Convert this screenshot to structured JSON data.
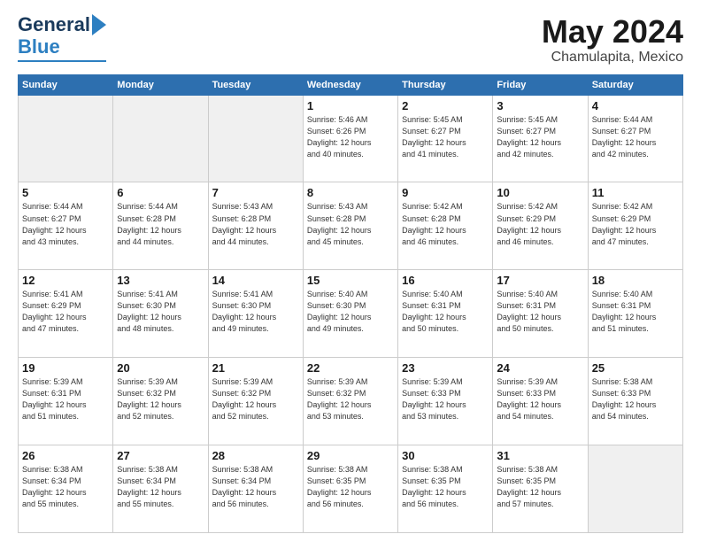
{
  "header": {
    "logo_general": "General",
    "logo_blue": "Blue",
    "title": "May 2024",
    "location": "Chamulapita, Mexico"
  },
  "weekdays": [
    "Sunday",
    "Monday",
    "Tuesday",
    "Wednesday",
    "Thursday",
    "Friday",
    "Saturday"
  ],
  "weeks": [
    [
      {
        "day": "",
        "info": ""
      },
      {
        "day": "",
        "info": ""
      },
      {
        "day": "",
        "info": ""
      },
      {
        "day": "1",
        "info": "Sunrise: 5:46 AM\nSunset: 6:26 PM\nDaylight: 12 hours\nand 40 minutes."
      },
      {
        "day": "2",
        "info": "Sunrise: 5:45 AM\nSunset: 6:27 PM\nDaylight: 12 hours\nand 41 minutes."
      },
      {
        "day": "3",
        "info": "Sunrise: 5:45 AM\nSunset: 6:27 PM\nDaylight: 12 hours\nand 42 minutes."
      },
      {
        "day": "4",
        "info": "Sunrise: 5:44 AM\nSunset: 6:27 PM\nDaylight: 12 hours\nand 42 minutes."
      }
    ],
    [
      {
        "day": "5",
        "info": "Sunrise: 5:44 AM\nSunset: 6:27 PM\nDaylight: 12 hours\nand 43 minutes."
      },
      {
        "day": "6",
        "info": "Sunrise: 5:44 AM\nSunset: 6:28 PM\nDaylight: 12 hours\nand 44 minutes."
      },
      {
        "day": "7",
        "info": "Sunrise: 5:43 AM\nSunset: 6:28 PM\nDaylight: 12 hours\nand 44 minutes."
      },
      {
        "day": "8",
        "info": "Sunrise: 5:43 AM\nSunset: 6:28 PM\nDaylight: 12 hours\nand 45 minutes."
      },
      {
        "day": "9",
        "info": "Sunrise: 5:42 AM\nSunset: 6:28 PM\nDaylight: 12 hours\nand 46 minutes."
      },
      {
        "day": "10",
        "info": "Sunrise: 5:42 AM\nSunset: 6:29 PM\nDaylight: 12 hours\nand 46 minutes."
      },
      {
        "day": "11",
        "info": "Sunrise: 5:42 AM\nSunset: 6:29 PM\nDaylight: 12 hours\nand 47 minutes."
      }
    ],
    [
      {
        "day": "12",
        "info": "Sunrise: 5:41 AM\nSunset: 6:29 PM\nDaylight: 12 hours\nand 47 minutes."
      },
      {
        "day": "13",
        "info": "Sunrise: 5:41 AM\nSunset: 6:30 PM\nDaylight: 12 hours\nand 48 minutes."
      },
      {
        "day": "14",
        "info": "Sunrise: 5:41 AM\nSunset: 6:30 PM\nDaylight: 12 hours\nand 49 minutes."
      },
      {
        "day": "15",
        "info": "Sunrise: 5:40 AM\nSunset: 6:30 PM\nDaylight: 12 hours\nand 49 minutes."
      },
      {
        "day": "16",
        "info": "Sunrise: 5:40 AM\nSunset: 6:31 PM\nDaylight: 12 hours\nand 50 minutes."
      },
      {
        "day": "17",
        "info": "Sunrise: 5:40 AM\nSunset: 6:31 PM\nDaylight: 12 hours\nand 50 minutes."
      },
      {
        "day": "18",
        "info": "Sunrise: 5:40 AM\nSunset: 6:31 PM\nDaylight: 12 hours\nand 51 minutes."
      }
    ],
    [
      {
        "day": "19",
        "info": "Sunrise: 5:39 AM\nSunset: 6:31 PM\nDaylight: 12 hours\nand 51 minutes."
      },
      {
        "day": "20",
        "info": "Sunrise: 5:39 AM\nSunset: 6:32 PM\nDaylight: 12 hours\nand 52 minutes."
      },
      {
        "day": "21",
        "info": "Sunrise: 5:39 AM\nSunset: 6:32 PM\nDaylight: 12 hours\nand 52 minutes."
      },
      {
        "day": "22",
        "info": "Sunrise: 5:39 AM\nSunset: 6:32 PM\nDaylight: 12 hours\nand 53 minutes."
      },
      {
        "day": "23",
        "info": "Sunrise: 5:39 AM\nSunset: 6:33 PM\nDaylight: 12 hours\nand 53 minutes."
      },
      {
        "day": "24",
        "info": "Sunrise: 5:39 AM\nSunset: 6:33 PM\nDaylight: 12 hours\nand 54 minutes."
      },
      {
        "day": "25",
        "info": "Sunrise: 5:38 AM\nSunset: 6:33 PM\nDaylight: 12 hours\nand 54 minutes."
      }
    ],
    [
      {
        "day": "26",
        "info": "Sunrise: 5:38 AM\nSunset: 6:34 PM\nDaylight: 12 hours\nand 55 minutes."
      },
      {
        "day": "27",
        "info": "Sunrise: 5:38 AM\nSunset: 6:34 PM\nDaylight: 12 hours\nand 55 minutes."
      },
      {
        "day": "28",
        "info": "Sunrise: 5:38 AM\nSunset: 6:34 PM\nDaylight: 12 hours\nand 56 minutes."
      },
      {
        "day": "29",
        "info": "Sunrise: 5:38 AM\nSunset: 6:35 PM\nDaylight: 12 hours\nand 56 minutes."
      },
      {
        "day": "30",
        "info": "Sunrise: 5:38 AM\nSunset: 6:35 PM\nDaylight: 12 hours\nand 56 minutes."
      },
      {
        "day": "31",
        "info": "Sunrise: 5:38 AM\nSunset: 6:35 PM\nDaylight: 12 hours\nand 57 minutes."
      },
      {
        "day": "",
        "info": ""
      }
    ]
  ]
}
